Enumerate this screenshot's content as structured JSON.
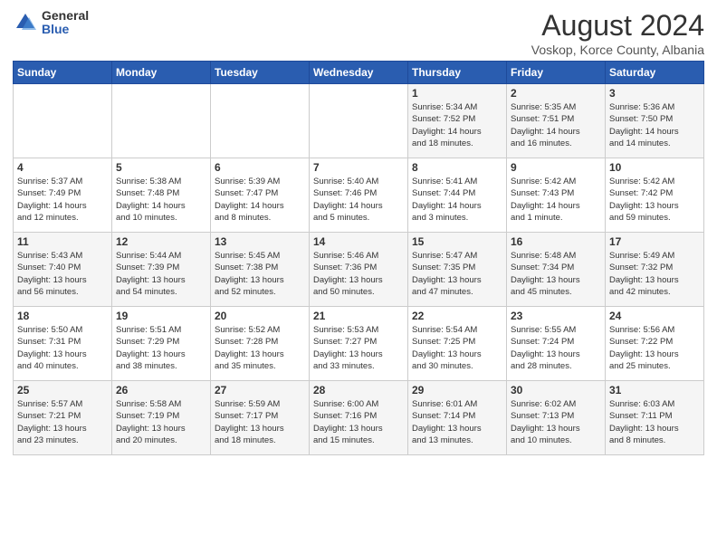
{
  "header": {
    "logo_general": "General",
    "logo_blue": "Blue",
    "title": "August 2024",
    "location": "Voskop, Korce County, Albania"
  },
  "weekdays": [
    "Sunday",
    "Monday",
    "Tuesday",
    "Wednesday",
    "Thursday",
    "Friday",
    "Saturday"
  ],
  "weeks": [
    [
      {
        "day": "",
        "content": ""
      },
      {
        "day": "",
        "content": ""
      },
      {
        "day": "",
        "content": ""
      },
      {
        "day": "",
        "content": ""
      },
      {
        "day": "1",
        "content": "Sunrise: 5:34 AM\nSunset: 7:52 PM\nDaylight: 14 hours\nand 18 minutes."
      },
      {
        "day": "2",
        "content": "Sunrise: 5:35 AM\nSunset: 7:51 PM\nDaylight: 14 hours\nand 16 minutes."
      },
      {
        "day": "3",
        "content": "Sunrise: 5:36 AM\nSunset: 7:50 PM\nDaylight: 14 hours\nand 14 minutes."
      }
    ],
    [
      {
        "day": "4",
        "content": "Sunrise: 5:37 AM\nSunset: 7:49 PM\nDaylight: 14 hours\nand 12 minutes."
      },
      {
        "day": "5",
        "content": "Sunrise: 5:38 AM\nSunset: 7:48 PM\nDaylight: 14 hours\nand 10 minutes."
      },
      {
        "day": "6",
        "content": "Sunrise: 5:39 AM\nSunset: 7:47 PM\nDaylight: 14 hours\nand 8 minutes."
      },
      {
        "day": "7",
        "content": "Sunrise: 5:40 AM\nSunset: 7:46 PM\nDaylight: 14 hours\nand 5 minutes."
      },
      {
        "day": "8",
        "content": "Sunrise: 5:41 AM\nSunset: 7:44 PM\nDaylight: 14 hours\nand 3 minutes."
      },
      {
        "day": "9",
        "content": "Sunrise: 5:42 AM\nSunset: 7:43 PM\nDaylight: 14 hours\nand 1 minute."
      },
      {
        "day": "10",
        "content": "Sunrise: 5:42 AM\nSunset: 7:42 PM\nDaylight: 13 hours\nand 59 minutes."
      }
    ],
    [
      {
        "day": "11",
        "content": "Sunrise: 5:43 AM\nSunset: 7:40 PM\nDaylight: 13 hours\nand 56 minutes."
      },
      {
        "day": "12",
        "content": "Sunrise: 5:44 AM\nSunset: 7:39 PM\nDaylight: 13 hours\nand 54 minutes."
      },
      {
        "day": "13",
        "content": "Sunrise: 5:45 AM\nSunset: 7:38 PM\nDaylight: 13 hours\nand 52 minutes."
      },
      {
        "day": "14",
        "content": "Sunrise: 5:46 AM\nSunset: 7:36 PM\nDaylight: 13 hours\nand 50 minutes."
      },
      {
        "day": "15",
        "content": "Sunrise: 5:47 AM\nSunset: 7:35 PM\nDaylight: 13 hours\nand 47 minutes."
      },
      {
        "day": "16",
        "content": "Sunrise: 5:48 AM\nSunset: 7:34 PM\nDaylight: 13 hours\nand 45 minutes."
      },
      {
        "day": "17",
        "content": "Sunrise: 5:49 AM\nSunset: 7:32 PM\nDaylight: 13 hours\nand 42 minutes."
      }
    ],
    [
      {
        "day": "18",
        "content": "Sunrise: 5:50 AM\nSunset: 7:31 PM\nDaylight: 13 hours\nand 40 minutes."
      },
      {
        "day": "19",
        "content": "Sunrise: 5:51 AM\nSunset: 7:29 PM\nDaylight: 13 hours\nand 38 minutes."
      },
      {
        "day": "20",
        "content": "Sunrise: 5:52 AM\nSunset: 7:28 PM\nDaylight: 13 hours\nand 35 minutes."
      },
      {
        "day": "21",
        "content": "Sunrise: 5:53 AM\nSunset: 7:27 PM\nDaylight: 13 hours\nand 33 minutes."
      },
      {
        "day": "22",
        "content": "Sunrise: 5:54 AM\nSunset: 7:25 PM\nDaylight: 13 hours\nand 30 minutes."
      },
      {
        "day": "23",
        "content": "Sunrise: 5:55 AM\nSunset: 7:24 PM\nDaylight: 13 hours\nand 28 minutes."
      },
      {
        "day": "24",
        "content": "Sunrise: 5:56 AM\nSunset: 7:22 PM\nDaylight: 13 hours\nand 25 minutes."
      }
    ],
    [
      {
        "day": "25",
        "content": "Sunrise: 5:57 AM\nSunset: 7:21 PM\nDaylight: 13 hours\nand 23 minutes."
      },
      {
        "day": "26",
        "content": "Sunrise: 5:58 AM\nSunset: 7:19 PM\nDaylight: 13 hours\nand 20 minutes."
      },
      {
        "day": "27",
        "content": "Sunrise: 5:59 AM\nSunset: 7:17 PM\nDaylight: 13 hours\nand 18 minutes."
      },
      {
        "day": "28",
        "content": "Sunrise: 6:00 AM\nSunset: 7:16 PM\nDaylight: 13 hours\nand 15 minutes."
      },
      {
        "day": "29",
        "content": "Sunrise: 6:01 AM\nSunset: 7:14 PM\nDaylight: 13 hours\nand 13 minutes."
      },
      {
        "day": "30",
        "content": "Sunrise: 6:02 AM\nSunset: 7:13 PM\nDaylight: 13 hours\nand 10 minutes."
      },
      {
        "day": "31",
        "content": "Sunrise: 6:03 AM\nSunset: 7:11 PM\nDaylight: 13 hours\nand 8 minutes."
      }
    ]
  ]
}
